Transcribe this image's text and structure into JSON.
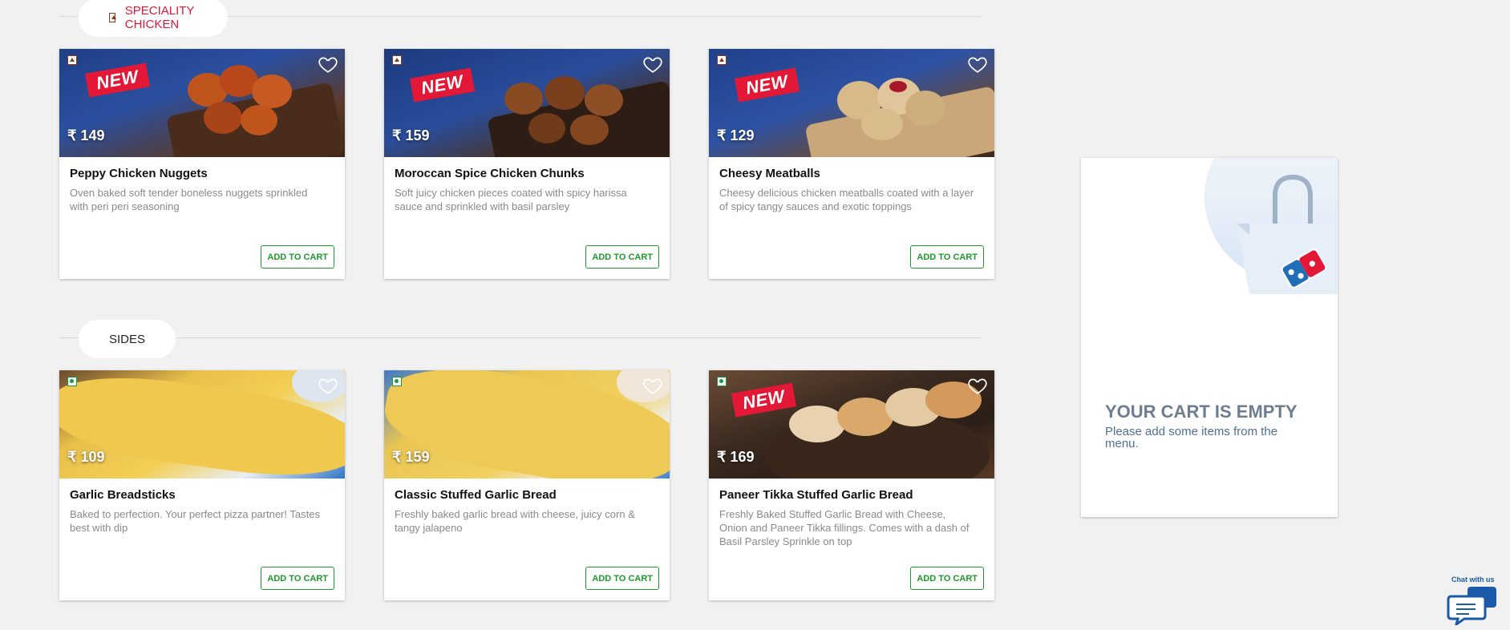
{
  "sections": [
    {
      "title": "SPECIALITY CHICKEN",
      "type": "nonveg"
    },
    {
      "title": "SIDES",
      "type": "veg"
    }
  ],
  "items": [
    {
      "name": "Peppy Chicken Nuggets",
      "price": "₹ 149",
      "description": "Oven baked soft tender boneless nuggets sprinkled with peri peri seasoning",
      "badge": "NEW",
      "button": "ADD TO CART"
    },
    {
      "name": "Moroccan Spice Chicken Chunks",
      "price": "₹ 159",
      "description": "Soft juicy chicken pieces coated with spicy harissa sauce and sprinkled with basil parsley",
      "badge": "NEW",
      "button": "ADD TO CART"
    },
    {
      "name": "Cheesy Meatballs",
      "price": "₹ 129",
      "description": "Cheesy delicious chicken meatballs coated with a layer of spicy tangy sauces and exotic toppings",
      "badge": "NEW",
      "button": "ADD TO CART"
    },
    {
      "name": "Garlic Breadsticks",
      "price": "₹ 109",
      "description": "Baked to perfection. Your perfect pizza partner! Tastes best with dip",
      "button": "ADD TO CART"
    },
    {
      "name": "Classic Stuffed Garlic Bread",
      "price": "₹ 159",
      "description": "Freshly baked garlic bread with cheese, juicy corn & tangy jalapeno",
      "button": "ADD TO CART"
    },
    {
      "name": "Paneer Tikka Stuffed Garlic Bread",
      "price": "₹ 169",
      "description": "Freshly Baked Stuffed Garlic Bread with Cheese, Onion and Paneer Tikka fillings. Comes with a dash of Basil Parsley Sprinkle on top",
      "badge": "NEW",
      "button": "ADD TO CART"
    }
  ],
  "cart": {
    "title": "YOUR CART IS EMPTY",
    "subtitle": "Please add some items from the menu."
  },
  "chat": {
    "label": "Chat with us"
  },
  "colors": {
    "accent_red": "#e31837",
    "button_green": "#1e9a2c",
    "nonveg": "#8b3a1a",
    "veg": "#1a9a3a"
  }
}
